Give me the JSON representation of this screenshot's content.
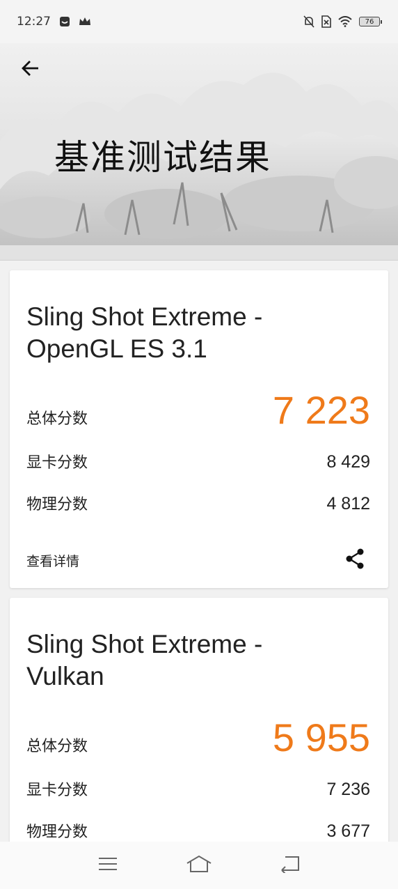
{
  "status_bar": {
    "time": "12:27",
    "battery": "76",
    "left_icons": [
      "message-icon",
      "crown-icon"
    ],
    "right_icons": [
      "bell-off-icon",
      "no-sim-icon",
      "wifi-icon",
      "battery-icon"
    ]
  },
  "header": {
    "title": "基准测试结果",
    "back_icon": "arrow-left-icon"
  },
  "results": [
    {
      "title_line1": "Sling Shot Extreme -",
      "title_line2": "OpenGL ES 3.1",
      "overall_label": "总体分数",
      "overall_score": "7 223",
      "graphics_label": "显卡分数",
      "graphics_score": "8 429",
      "physics_label": "物理分数",
      "physics_score": "4 812",
      "details_label": "查看详情",
      "share_icon": "share-icon"
    },
    {
      "title_line1": "Sling Shot Extreme -",
      "title_line2": "Vulkan",
      "overall_label": "总体分数",
      "overall_score": "5 955",
      "graphics_label": "显卡分数",
      "graphics_score": "7 236",
      "physics_label": "物理分数",
      "physics_score": "3 677"
    }
  ],
  "nav_bar": {
    "icons": [
      "menu-icon",
      "home-icon",
      "back-icon"
    ]
  },
  "colors": {
    "accent": "#ef7a1a",
    "card_bg": "#ffffff",
    "page_bg": "#f1f1f1"
  }
}
